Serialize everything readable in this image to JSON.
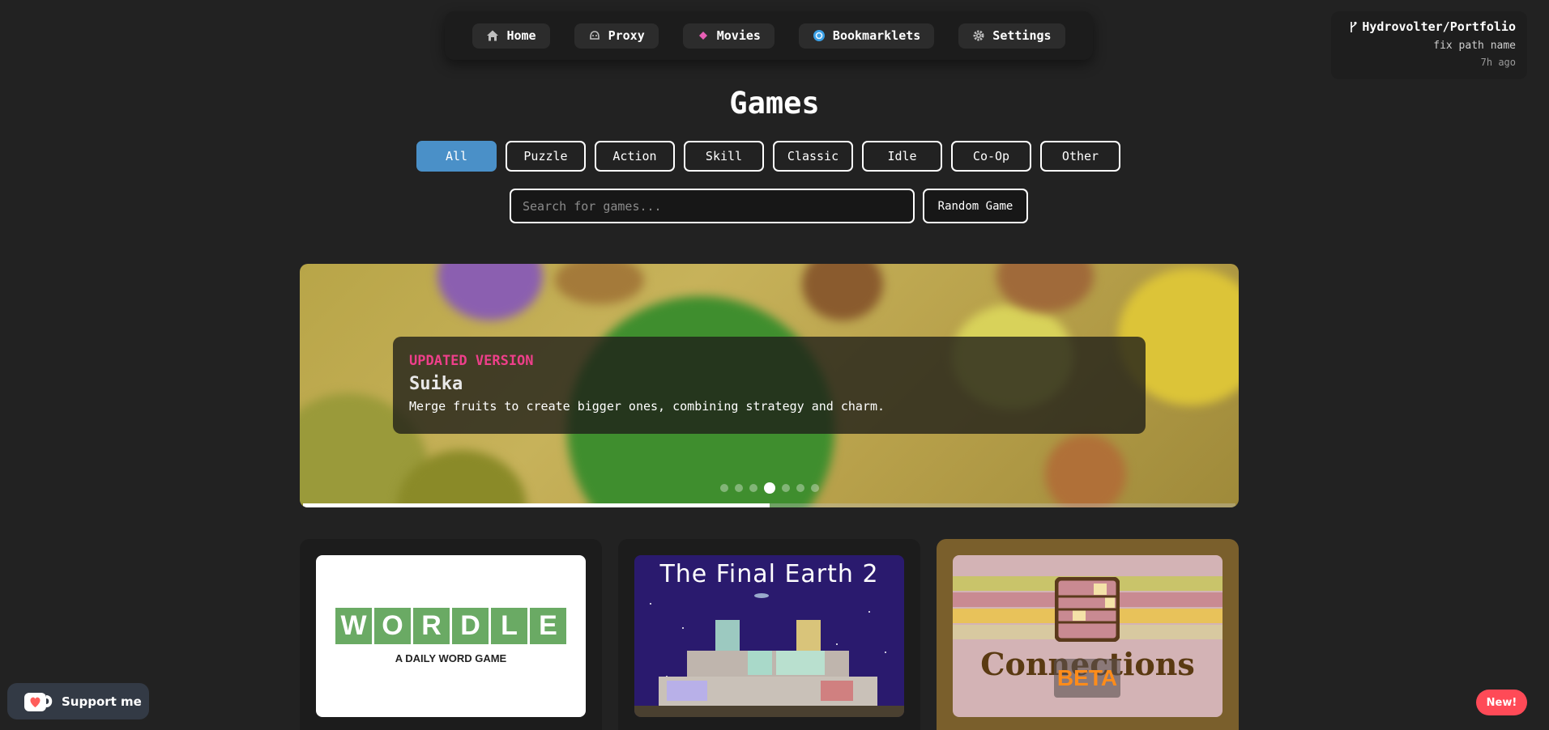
{
  "nav": {
    "items": [
      {
        "label": "Home",
        "icon": "home-icon"
      },
      {
        "label": "Proxy",
        "icon": "proxy-icon"
      },
      {
        "label": "Movies",
        "icon": "movies-icon"
      },
      {
        "label": "Bookmarklets",
        "icon": "bookmarklets-icon"
      },
      {
        "label": "Settings",
        "icon": "gear-icon"
      }
    ]
  },
  "commit": {
    "repo": "Hydrovolter/Portfolio",
    "message": "fix path name",
    "time": "7h ago",
    "icon": "git-branch-icon"
  },
  "page": {
    "title": "Games"
  },
  "filters": {
    "items": [
      "All",
      "Puzzle",
      "Action",
      "Skill",
      "Classic",
      "Idle",
      "Co-Op",
      "Other"
    ],
    "active": "All",
    "active_color": "#4a90c8"
  },
  "search": {
    "placeholder": "Search for games...",
    "value": ""
  },
  "random_button": {
    "label": "Random Game"
  },
  "carousel": {
    "tag": "UPDATED VERSION",
    "tag_color": "#ee3f8a",
    "title": "Suika",
    "description": "Merge fruits to create bigger ones, combining strategy and charm.",
    "slide_count": 7,
    "active_slide": 4,
    "progress": 0.5
  },
  "games": [
    {
      "name": "Wordle",
      "logo_letters": [
        "W",
        "O",
        "R",
        "D",
        "L",
        "E"
      ],
      "subtitle": "A DAILY WORD GAME"
    },
    {
      "name": "The Final Earth 2",
      "title": "The Final Earth 2"
    },
    {
      "name": "Connections",
      "title": "Connections",
      "badge": "BETA"
    }
  ],
  "support": {
    "label": "Support me",
    "icon": "kofi-cup-icon"
  },
  "new_badge": {
    "label": "New!",
    "color": "#ff4a57"
  }
}
